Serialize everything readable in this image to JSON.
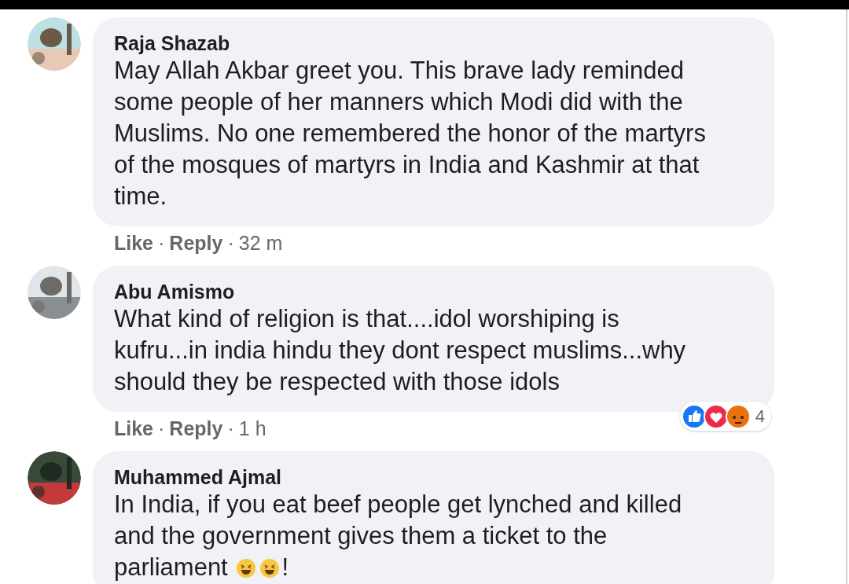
{
  "comments": [
    {
      "author": "Raja Shazab",
      "avatar": {
        "kind": "picture"
      },
      "lines": [
        "May Allah Akbar greet you. This brave lady reminded",
        "some people of her manners which Modi did with the",
        "Muslims. No one remembered the honor of the martyrs",
        "of the mosques of martyrs in India and Kashmir at that",
        "time."
      ],
      "actions": [
        "Like",
        "Reply"
      ],
      "separator": "·",
      "time": "32 m"
    },
    {
      "author": "Abu Amismo",
      "avatar": {
        "kind": "picture"
      },
      "lines": [
        "What kind of religion is that....idol worshiping is",
        "kufru...in india hindu they dont respect muslims...why",
        "should they be respected with those idols"
      ],
      "actions": [
        "Like",
        "Reply"
      ],
      "separator": "·",
      "time": "1 h",
      "reactions": {
        "kinds": [
          {
            "kind": "like"
          },
          {
            "kind": "love"
          },
          {
            "kind": "angry"
          }
        ],
        "count": "4"
      }
    },
    {
      "author": "Muhammed Ajmal",
      "avatar": {
        "kind": "picture"
      },
      "lines": [
        "In India, if you eat beef people get lynched and killed",
        "and the government gives them a ticket to the",
        "parliament"
      ],
      "line_end": {
        "emojis": [
          {
            "kind": "laugh"
          },
          {
            "kind": "laugh"
          }
        ],
        "text": "!"
      }
    }
  ]
}
